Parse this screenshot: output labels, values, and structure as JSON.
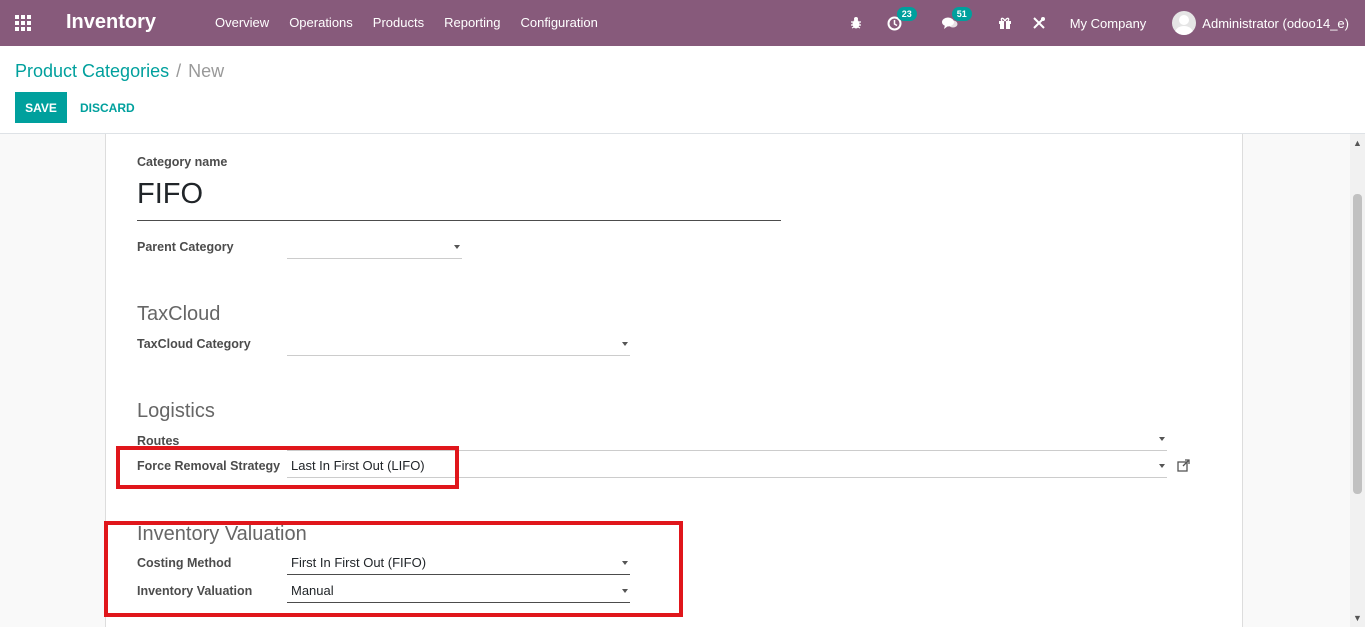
{
  "navbar": {
    "app_title": "Inventory",
    "menu": [
      "Overview",
      "Operations",
      "Products",
      "Reporting",
      "Configuration"
    ],
    "activity_count": "23",
    "messages_count": "51",
    "company": "My Company",
    "user": "Administrator (odoo14_e)",
    "accent_color": "#875a7b"
  },
  "breadcrumb": {
    "parent": "Product Categories",
    "separator": "/",
    "current": "New"
  },
  "actions": {
    "save_label": "SAVE",
    "discard_label": "DISCARD"
  },
  "form": {
    "category_name_label": "Category name",
    "category_name_value": "FIFO",
    "parent_category_label": "Parent Category",
    "parent_category_value": "",
    "taxcloud_section": "TaxCloud",
    "taxcloud_category_label": "TaxCloud Category",
    "taxcloud_category_value": "",
    "logistics_section": "Logistics",
    "routes_label": "Routes",
    "routes_value": "",
    "removal_strategy_label": "Force Removal Strategy",
    "removal_strategy_value": "Last In First Out (LIFO)",
    "valuation_section": "Inventory Valuation",
    "costing_method_label": "Costing Method",
    "costing_method_value": "First In First Out (FIFO)",
    "inventory_valuation_label": "Inventory Valuation",
    "inventory_valuation_value": "Manual"
  },
  "colors": {
    "primary": "#00a09d",
    "highlight": "#e0161b"
  }
}
